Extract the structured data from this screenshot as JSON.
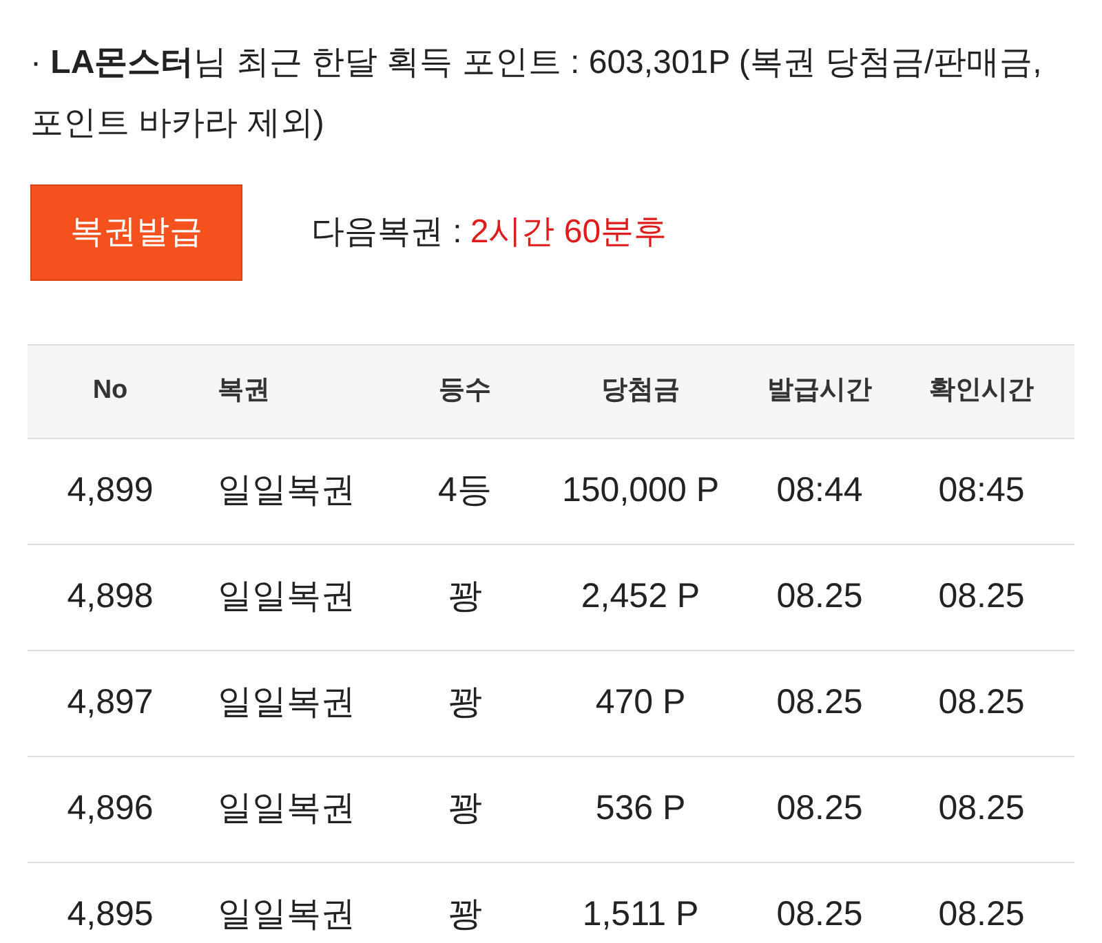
{
  "notice": "· **LA몬스터**님 최근 한달 획득 포인트 : 603,301P (복권 당첨금/판매금, 포인트 바카라 제외)",
  "issue_button": "복권발급",
  "next_ticket": {
    "label": "다음복권 :",
    "value": "2시간 60분후"
  },
  "table": {
    "columns": [
      "No",
      "복권",
      "등수",
      "당첨금",
      "발급시간",
      "확인시간"
    ],
    "rows": [
      [
        "4,899",
        "일일복권",
        "4등",
        "150,000 P",
        "08:44",
        "08:45"
      ],
      [
        "4,898",
        "일일복권",
        "꽝",
        "2,452 P",
        "08.25",
        "08.25"
      ],
      [
        "4,897",
        "일일복권",
        "꽝",
        "470 P",
        "08.25",
        "08.25"
      ],
      [
        "4,896",
        "일일복권",
        "꽝",
        "536 P",
        "08.25",
        "08.25"
      ],
      [
        "4,895",
        "일일복권",
        "꽝",
        "1,511 P",
        "08.25",
        "08.25"
      ]
    ]
  }
}
